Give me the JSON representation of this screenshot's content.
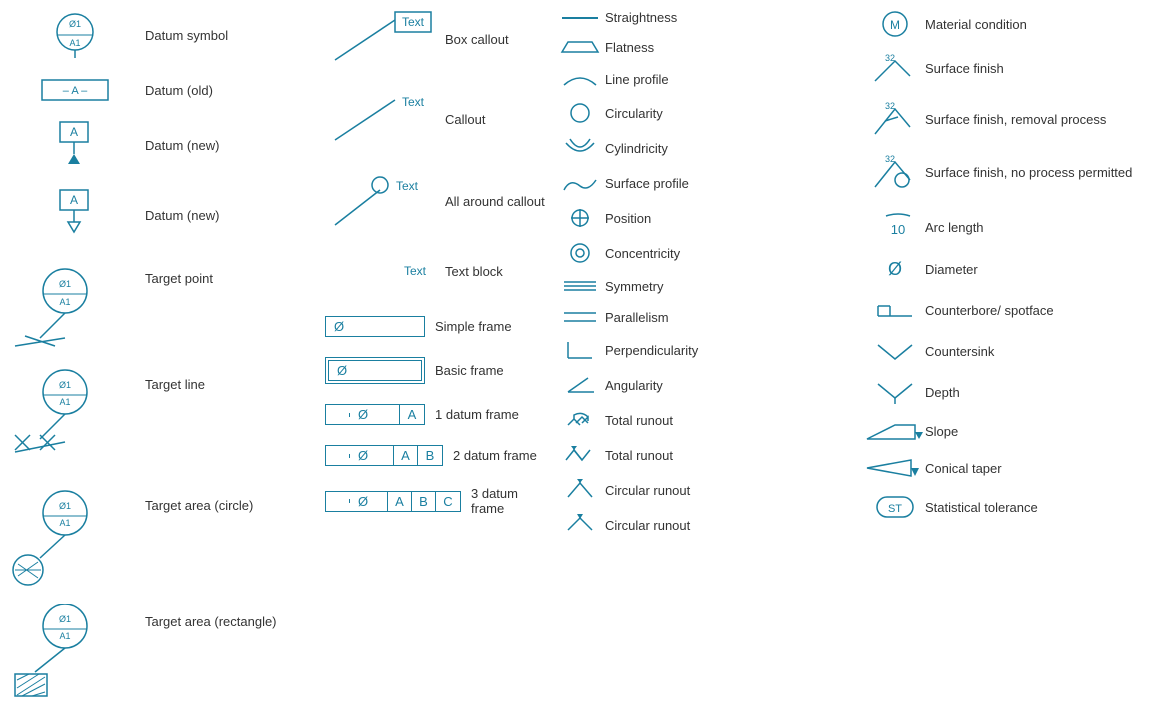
{
  "col1": {
    "items": [
      {
        "id": "datum-symbol",
        "label": "Datum symbol"
      },
      {
        "id": "datum-old",
        "label": "Datum (old)"
      },
      {
        "id": "datum-new1",
        "label": "Datum (new)"
      },
      {
        "id": "datum-new2",
        "label": "Datum (new)"
      },
      {
        "id": "target-point",
        "label": "Target point"
      },
      {
        "id": "target-line",
        "label": "Target line"
      },
      {
        "id": "target-area-circle",
        "label": "Target area (circle)"
      },
      {
        "id": "target-area-rect",
        "label": "Target area (rectangle)"
      }
    ]
  },
  "col2": {
    "callouts": [
      {
        "id": "box-callout",
        "text": "Text",
        "label": "Box callout"
      },
      {
        "id": "callout",
        "text": "Text",
        "label": "Callout"
      },
      {
        "id": "all-around-callout",
        "text": "Text",
        "label": "All around callout"
      },
      {
        "id": "text-block",
        "text": "Text",
        "label": "Text block"
      }
    ],
    "frames": [
      {
        "id": "simple-frame",
        "symbol": "Ø",
        "label": "Simple frame",
        "cells": [
          "Ø"
        ]
      },
      {
        "id": "basic-frame",
        "symbol": "Ø",
        "label": "Basic frame",
        "cells": [
          "Ø"
        ]
      },
      {
        "id": "1-datum-frame",
        "symbol": "Ø",
        "label": "1 datum frame",
        "cells": [
          "Ø",
          "A"
        ]
      },
      {
        "id": "2-datum-frame",
        "symbol": "Ø",
        "label": "2 datum frame",
        "cells": [
          "Ø",
          "A",
          "B"
        ]
      },
      {
        "id": "3-datum-frame",
        "symbol": "Ø",
        "label": "3 datum frame",
        "cells": [
          "Ø",
          "A",
          "B",
          "C"
        ]
      }
    ]
  },
  "col3": {
    "items": [
      {
        "id": "straightness",
        "label": "Straightness"
      },
      {
        "id": "flatness",
        "label": "Flatness"
      },
      {
        "id": "line-profile",
        "label": "Line profile"
      },
      {
        "id": "circularity",
        "label": "Circularity"
      },
      {
        "id": "cylindricity",
        "label": "Cylindricity"
      },
      {
        "id": "surface-profile",
        "label": "Surface profile"
      },
      {
        "id": "position",
        "label": "Position"
      },
      {
        "id": "concentricity",
        "label": "Concentricity"
      },
      {
        "id": "symmetry",
        "label": "Symmetry"
      },
      {
        "id": "parallelism",
        "label": "Parallelism"
      },
      {
        "id": "perpendicularity",
        "label": "Perpendicularity"
      },
      {
        "id": "angularity",
        "label": "Angularity"
      },
      {
        "id": "total-runout1",
        "label": "Total runout"
      },
      {
        "id": "total-runout2",
        "label": "Total runout"
      },
      {
        "id": "circular-runout1",
        "label": "Circular runout"
      },
      {
        "id": "circular-runout2",
        "label": "Circular runout"
      }
    ]
  },
  "col4": {
    "items": [
      {
        "id": "material-condition",
        "label": "Material condition"
      },
      {
        "id": "surface-finish1",
        "label": "Surface finish"
      },
      {
        "id": "surface-finish2",
        "label": "Surface finish, removal process"
      },
      {
        "id": "surface-finish3",
        "label": "Surface finish, no process permitted"
      },
      {
        "id": "arc-length",
        "label": "Arc length"
      },
      {
        "id": "diameter",
        "label": "Diameter"
      },
      {
        "id": "counterbore",
        "label": "Counterbore/ spotface"
      },
      {
        "id": "countersink",
        "label": "Countersink"
      },
      {
        "id": "depth",
        "label": "Depth"
      },
      {
        "id": "slope",
        "label": "Slope"
      },
      {
        "id": "conical-taper",
        "label": "Conical taper"
      },
      {
        "id": "statistical-tolerance",
        "label": "Statistical tolerance"
      }
    ]
  }
}
